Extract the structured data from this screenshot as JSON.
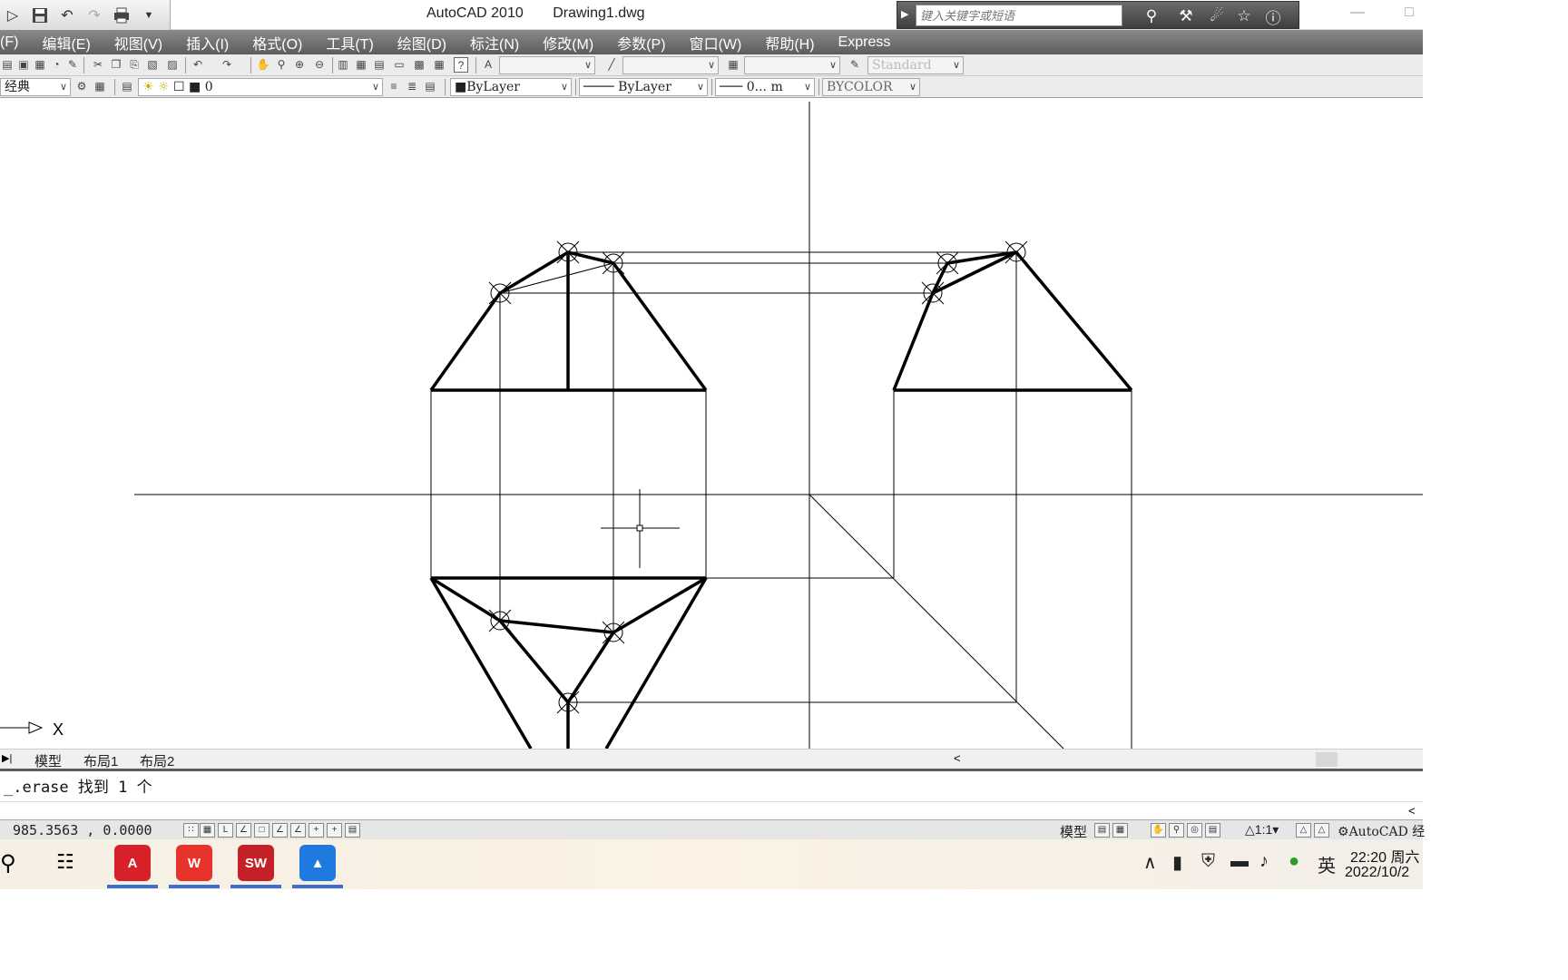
{
  "app": {
    "title": "AutoCAD 2010",
    "document": "Drawing1.dwg"
  },
  "search": {
    "placeholder": "键入关键字或短语"
  },
  "menu": {
    "items": [
      "(F)",
      "编辑(E)",
      "视图(V)",
      "插入(I)",
      "格式(O)",
      "工具(T)",
      "绘图(D)",
      "标注(N)",
      "修改(M)",
      "参数(P)",
      "窗口(W)",
      "帮助(H)",
      "Express"
    ]
  },
  "toolbar": {
    "text_style": "Standard",
    "workspace": "经典",
    "layer": "0",
    "color": "ByLayer",
    "linetype": "ByLayer",
    "lineweight": "0...",
    "lineweight_suffix": "m",
    "plotstyle": "BYCOLOR"
  },
  "ucs": {
    "x_label": "X"
  },
  "tabs": [
    "模型",
    "布局1",
    "布局2"
  ],
  "command": {
    "history": "_.erase 找到 1 个"
  },
  "status": {
    "coordinates": "985.3563 ,  0.0000",
    "model": "模型",
    "annotation_scale": "1:1",
    "workspace": "AutoCAD 经"
  },
  "taskbar": {
    "apps": [
      {
        "name": "AutoCAD",
        "label": "A",
        "color": "#d6202a"
      },
      {
        "name": "WPS",
        "label": "W",
        "color": "#e8322c"
      },
      {
        "name": "SolidWorks",
        "label": "SW",
        "color": "#c42027"
      },
      {
        "name": "Photos",
        "label": "",
        "color": "#1f7ae0"
      }
    ],
    "ime": "英",
    "time": "22:20 周六",
    "date": "2022/10/2"
  }
}
